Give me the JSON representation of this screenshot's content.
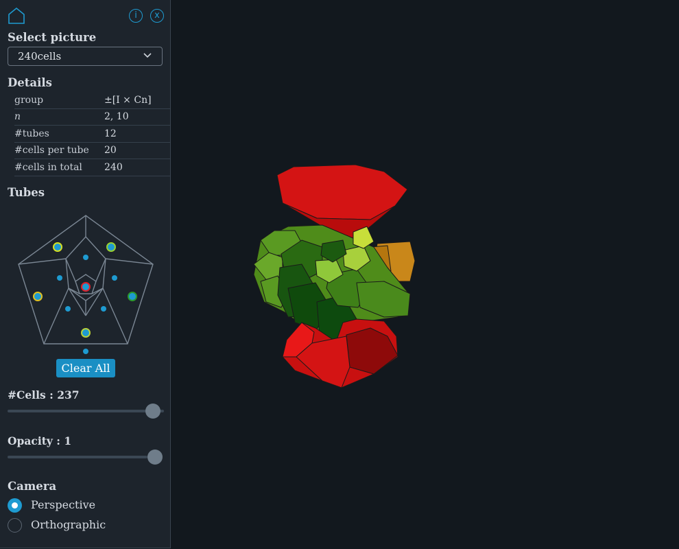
{
  "header": {
    "home_icon": "home-icon",
    "info_icon": "i",
    "close_icon": "x"
  },
  "select": {
    "label": "Select picture",
    "value": "240cells"
  },
  "details": {
    "heading": "Details",
    "rows": [
      {
        "key": "group",
        "value": "±[I × Cn]"
      },
      {
        "key": "n",
        "value": "2, 10"
      },
      {
        "key": "#tubes",
        "value": "12"
      },
      {
        "key": "#cells per tube",
        "value": "20"
      },
      {
        "key": "#cells in total",
        "value": "240"
      }
    ]
  },
  "tubes": {
    "heading": "Tubes",
    "clear_label": "Clear All"
  },
  "cells_slider": {
    "label": "#Cells : 237",
    "value_fraction": 0.99
  },
  "opacity_slider": {
    "label": "Opacity : 1",
    "value_fraction": 1.0
  },
  "camera": {
    "heading": "Camera",
    "options": [
      {
        "label": "Perspective",
        "selected": true
      },
      {
        "label": "Orthographic",
        "selected": false
      }
    ]
  },
  "colors": {
    "accent": "#1e9bd1",
    "background": "#12181e",
    "panel": "#1d242c"
  }
}
